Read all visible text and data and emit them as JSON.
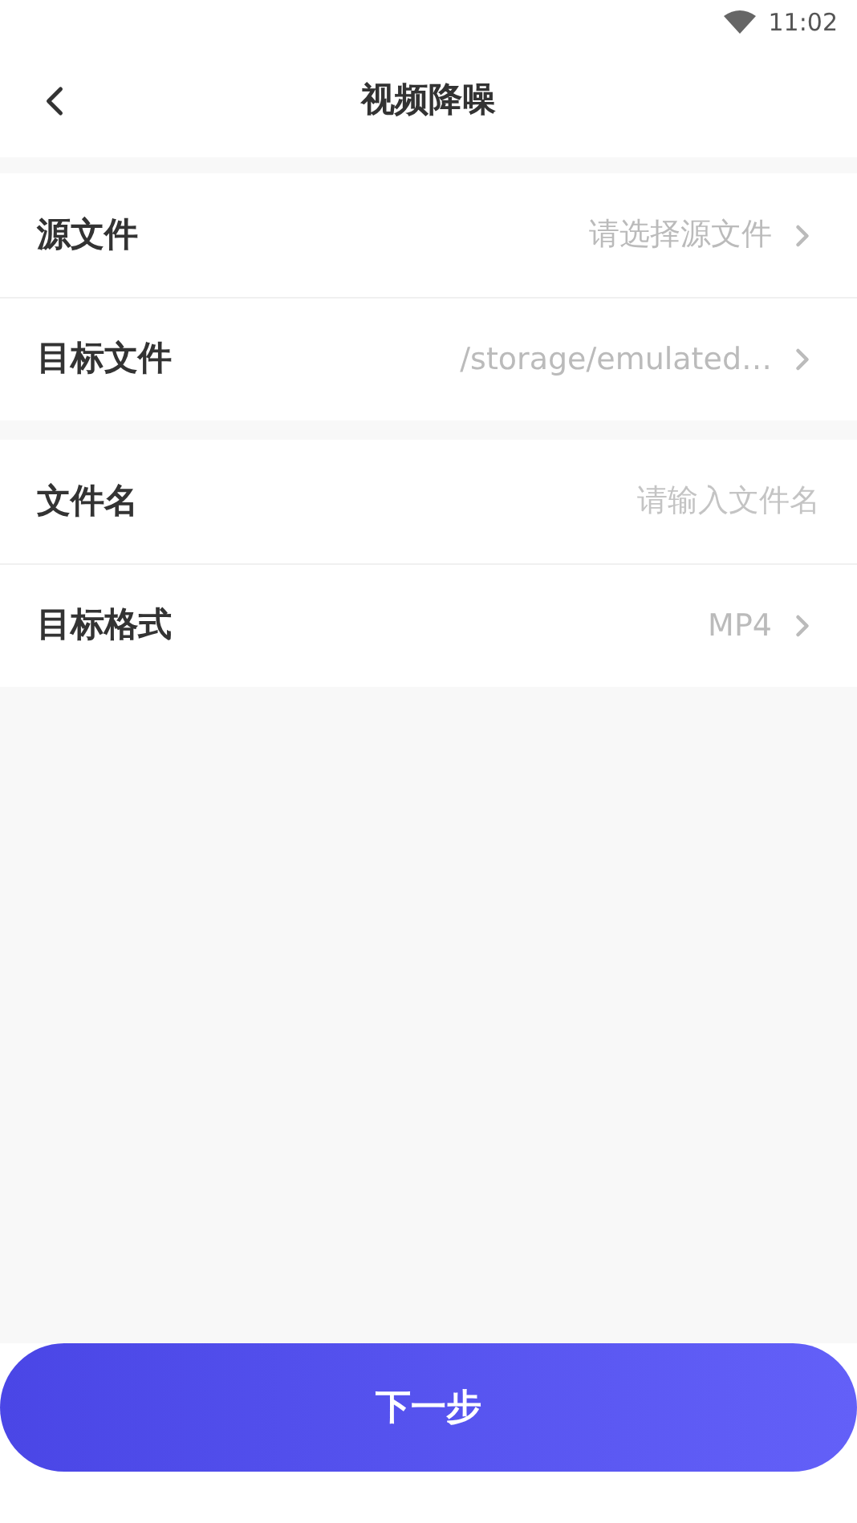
{
  "status_bar": {
    "time": "11:02"
  },
  "header": {
    "title": "视频降噪"
  },
  "sections": [
    {
      "rows": [
        {
          "kind": "select",
          "label": "源文件",
          "value": "请选择源文件"
        },
        {
          "kind": "select",
          "label": "目标文件",
          "value": "/storage/emulated…"
        }
      ]
    },
    {
      "rows": [
        {
          "kind": "input",
          "label": "文件名",
          "placeholder": "请输入文件名"
        },
        {
          "kind": "select",
          "label": "目标格式",
          "value": "MP4"
        }
      ]
    }
  ],
  "next_button": {
    "label": "下一步"
  }
}
